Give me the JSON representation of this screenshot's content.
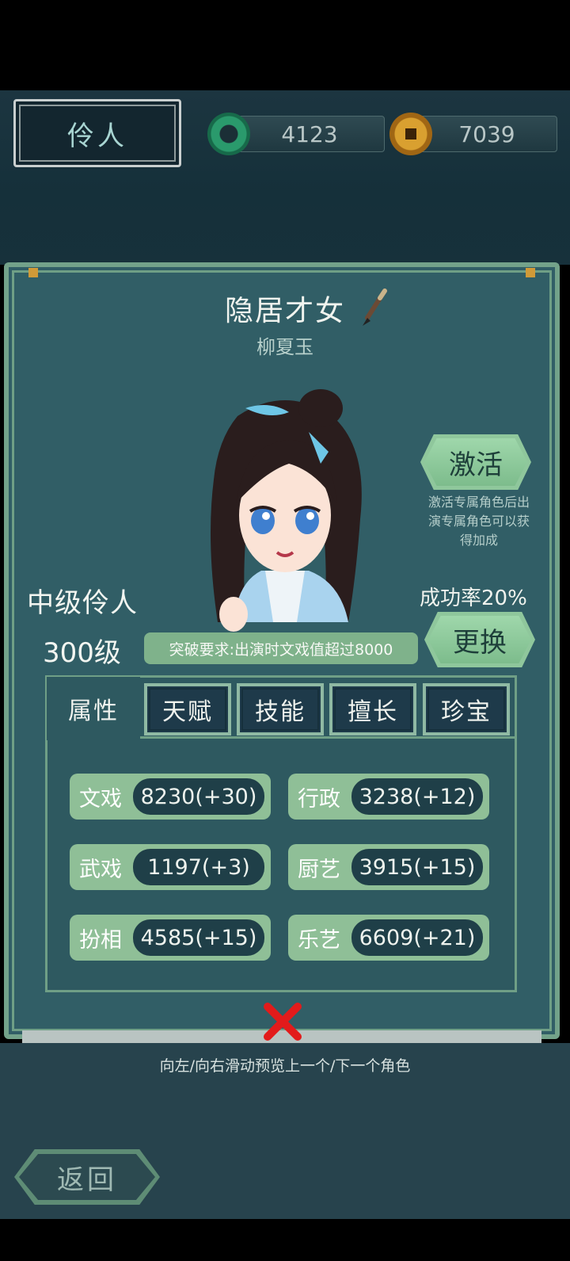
{
  "header": {
    "title": "伶人",
    "jade_amount": "4123",
    "coin_amount": "7039"
  },
  "character": {
    "title": "隐居才女",
    "name": "柳夏玉",
    "rank": "中级伶人",
    "level": "300级",
    "breakthrough": "突破要求:出演时文戏值超过8000"
  },
  "actions": {
    "activate_label": "激活",
    "activate_desc": "激活专属角色后出演专属角色可以获得加成",
    "success_rate": "成功率20%",
    "change_label": "更换"
  },
  "tabs": {
    "attributes": "属性",
    "talent": "天赋",
    "skills": "技能",
    "specialty": "擅长",
    "treasure": "珍宝"
  },
  "stats": [
    {
      "label": "文戏",
      "value": "8230(+30)"
    },
    {
      "label": "行政",
      "value": "3238(+12)"
    },
    {
      "label": "武戏",
      "value": "1197(+3)"
    },
    {
      "label": "厨艺",
      "value": "3915(+15)"
    },
    {
      "label": "扮相",
      "value": "4585(+15)"
    },
    {
      "label": "乐艺",
      "value": "6609(+21)"
    }
  ],
  "hint": "向左/向右滑动预览上一个/下一个角色",
  "back_label": "返回",
  "colors": {
    "panel": "#315e66",
    "accent_green": "#8fbf97",
    "value_bg": "#1f3f48",
    "close_red": "#e21b1b"
  },
  "icons": [
    "jade-coin-icon",
    "copper-coin-icon",
    "brush-icon",
    "close-icon"
  ]
}
